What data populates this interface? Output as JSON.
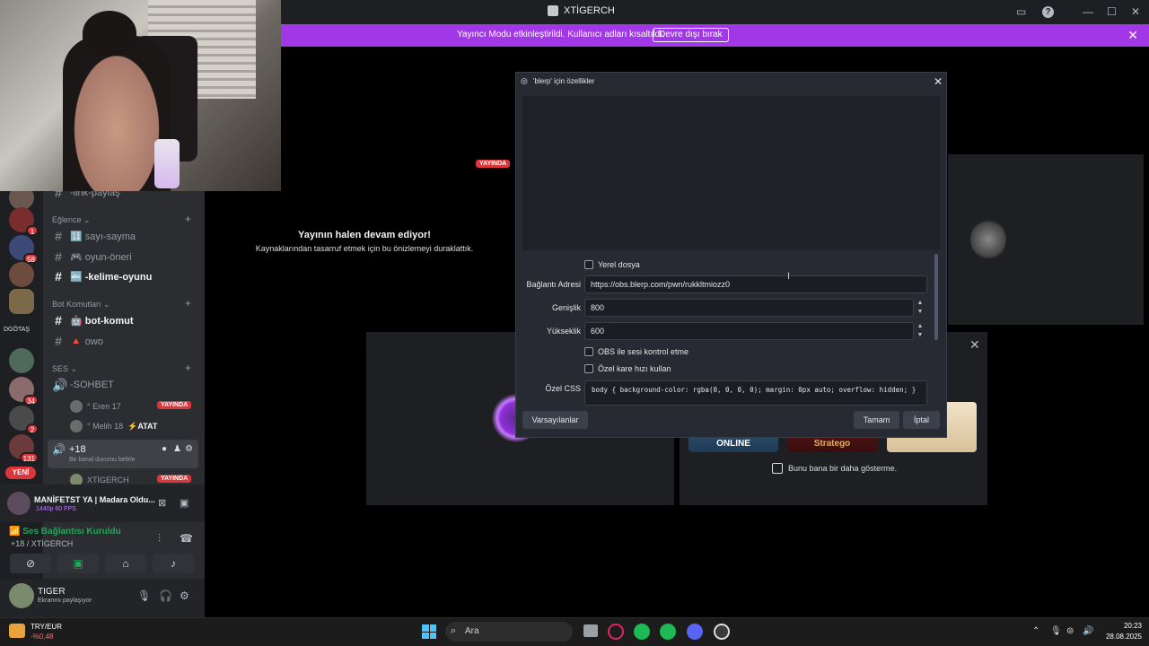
{
  "window": {
    "title": "XTİGERCH"
  },
  "banner": {
    "text": "Yayıncı Modu etkinleştirildi. Kullanıcı adları kısaltıldı.",
    "button": "Devre dışı bırak"
  },
  "rail": {
    "badges": [
      "1",
      "58",
      "34",
      "2",
      "131"
    ],
    "server_label": "DGÖTAŞ",
    "new_label": "YENİ"
  },
  "sidebar": {
    "partial_channel": "-link-paylaş",
    "categories": [
      "Eğlence",
      "Bot Komutları",
      "SES"
    ],
    "channels": {
      "sayi": "🔢 sayı-sayma",
      "oyun": "🎮 oyun-öneri",
      "kelime": "🔤 -kelime-oyunu",
      "bot": "🤖 bot-komut",
      "owo": "🔺 owo",
      "sohbet": "-SOHBET"
    },
    "voice_users": [
      {
        "name": "° Eren 17",
        "live": "YAYINDA"
      },
      {
        "name": "° Melih 18",
        "extra": "⚡ATAT"
      }
    ],
    "active_voice": {
      "name": "+18",
      "status": "Bir kanal durumu belirle"
    },
    "active_user": {
      "name": "XTİGERCH",
      "live": "YAYINDA"
    }
  },
  "stream_panel": {
    "title": "MANİFETST YA | Madara Oldu...",
    "meta": "1440p 60 FPS"
  },
  "voice": {
    "status": "Ses Bağlantısı Kuruldu",
    "channel": "+18 / XTİGERCH"
  },
  "user": {
    "name": "TIGER",
    "status": "Ekranını paylaşıyor"
  },
  "stage": {
    "live_badge": "YAYINDA",
    "paused_title": "Yayının halen devam ediyor!",
    "paused_body": "Kaynaklarından tasarruf etmek için bu önizlemeyi duraklattık.",
    "games": [
      "CODENAMES ONLINE",
      "Stratego",
      ""
    ],
    "dont_show": "Bunu bana bir daha gösterme."
  },
  "dialog": {
    "title": "'blerp' için özellikler",
    "local_file": "Yerel dosya",
    "url_label": "Bağlantı Adresi",
    "url_value": "https://obs.blerp.com/pwn/rukkltmiozz0",
    "width_label": "Genişlik",
    "width_value": "800",
    "height_label": "Yükseklik",
    "height_value": "600",
    "audio_cb": "OBS ile sesi kontrol etme",
    "fps_cb": "Özel kare hızı kullan",
    "css_label": "Özel CSS",
    "css_value": "body { background-color: rgba(0, 0, 0, 0); margin: 0px auto; overflow: hidden; }",
    "defaults_btn": "Varsayılanlar",
    "ok_btn": "Tamam",
    "cancel_btn": "İptal"
  },
  "taskbar": {
    "ticker_name": "TRY/EUR",
    "ticker_value": "-%0,48",
    "search": "Ara",
    "time": "20:23",
    "date": "28.08.2025"
  },
  "colors": {
    "accent": "#a237e8",
    "live": "#da373c",
    "online": "#23a55a"
  }
}
